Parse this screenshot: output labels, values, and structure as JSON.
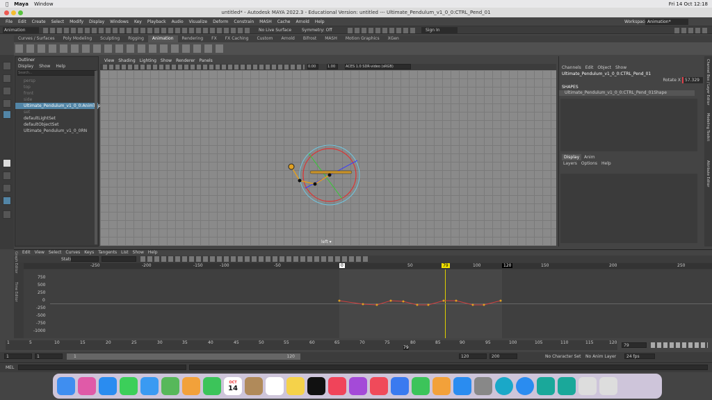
{
  "mac_menubar": {
    "app": "Maya",
    "window": "Window",
    "clock": "Fri 14 Oct  12:18"
  },
  "window_title": "untitled* - Autodesk MAYA 2022.3 - Educational Version: untitled   ---   Ultimate_Pendulum_v1_0_0:CTRL_Pend_01",
  "menubar": [
    "File",
    "Edit",
    "Create",
    "Select",
    "Modify",
    "Display",
    "Windows",
    "Key",
    "Playback",
    "Audio",
    "Visualize",
    "Deform",
    "Constrain",
    "MASH",
    "Cache",
    "Arnold",
    "Help"
  ],
  "workspace": {
    "label": "Workspace :",
    "value": "Animation*"
  },
  "statusline": {
    "menuset": "Animation",
    "live_surface": "No Live Surface",
    "symmetry": "Symmetry: Off",
    "sign_in": "Sign In"
  },
  "shelf_tabs": [
    "Curves / Surfaces",
    "Poly Modeling",
    "Sculpting",
    "Rigging",
    "Animation",
    "Rendering",
    "FX",
    "FX Caching",
    "Custom",
    "Arnold",
    "Bifrost",
    "MASH",
    "Motion Graphics",
    "XGen"
  ],
  "outliner": {
    "title": "Outliner",
    "menu": [
      "Display",
      "Show",
      "Help"
    ],
    "search_placeholder": "Search...",
    "items": [
      {
        "label": "persp",
        "dim": true
      },
      {
        "label": "top",
        "dim": true
      },
      {
        "label": "front",
        "dim": true
      },
      {
        "label": "side",
        "dim": true
      },
      {
        "label": "Ultimate_Pendulum_v1_0_0:AnimT_p",
        "sel": true
      },
      {
        "label": "set",
        "dim": true
      },
      {
        "label": "defaultLightSet"
      },
      {
        "label": "defaultObjectSet"
      },
      {
        "label": "Ultimate_Pendulum_v1_0_0RN"
      }
    ]
  },
  "viewport": {
    "menu": [
      "View",
      "Shading",
      "Lighting",
      "Show",
      "Renderer",
      "Panels"
    ],
    "field_a": "0.00",
    "field_b": "1.00",
    "colorspace": "ACES 1.0 SDR-video (sRGB)",
    "camera_label": "left ▾"
  },
  "channel_box": {
    "menu": [
      "Channels",
      "Edit",
      "Object",
      "Show"
    ],
    "object": "Ultimate_Pendulum_v1_0_0:CTRL_Pend_01",
    "attr_name": "Rotate X",
    "attr_value": "57.329",
    "shapes_label": "SHAPES",
    "shape": "Ultimate_Pendulum_v1_0_0:CTRL_Pend_01Shape"
  },
  "layer_editor": {
    "tabs": [
      "Display",
      "Anim"
    ],
    "menu": [
      "Layers",
      "Options",
      "Help"
    ]
  },
  "side_tabs": [
    "Channel Box / Layer Editor",
    "Modeling Toolkit",
    "Attribute Editor"
  ],
  "graph_editor": {
    "menu": [
      "Edit",
      "View",
      "Select",
      "Curves",
      "Keys",
      "Tangents",
      "List",
      "Show",
      "Help"
    ],
    "stats": "Stats",
    "frame_ticks": [
      "-250",
      "-200",
      "-150",
      "-100",
      "-50",
      "0",
      "50",
      "79",
      "100",
      "150",
      "200",
      "250"
    ],
    "value_ticks": [
      "750",
      "500",
      "250",
      "0",
      "-250",
      "-500",
      "-750",
      "-1000"
    ],
    "current_frame": "79",
    "end_frame": "120",
    "side_labels": [
      "Graph Editor",
      "Time Editor"
    ]
  },
  "timeline": {
    "ticks": [
      "1",
      "5",
      "10",
      "15",
      "20",
      "25",
      "30",
      "35",
      "40",
      "45",
      "50",
      "55",
      "60",
      "65",
      "70",
      "75",
      "80",
      "85",
      "90",
      "95",
      "100",
      "105",
      "110",
      "115",
      "120"
    ],
    "current": "79",
    "frame_field": "79"
  },
  "range": {
    "start": "1",
    "start2": "1",
    "range_start": "1",
    "range_end": "120",
    "end": "120",
    "end2": "200",
    "character_set": "No Character Set",
    "anim_layer": "No Anim Layer",
    "fps": "24 fps"
  },
  "mel": {
    "label": "MEL"
  },
  "dock": [
    {
      "name": "finder-icon",
      "c": "#3f8ef0"
    },
    {
      "name": "launchpad-icon",
      "c": "#e05aa8"
    },
    {
      "name": "safari-icon",
      "c": "#2a8cf0"
    },
    {
      "name": "messages-icon",
      "c": "#3ccf5a"
    },
    {
      "name": "mail-icon",
      "c": "#3a9af2"
    },
    {
      "name": "maps-icon",
      "c": "#57b85a"
    },
    {
      "name": "photos-icon",
      "c": "#f2a13a"
    },
    {
      "name": "facetime-icon",
      "c": "#3cc45a"
    },
    {
      "name": "calendar-icon",
      "c": "#ffffff"
    },
    {
      "name": "contacts-icon",
      "c": "#b08a5a"
    },
    {
      "name": "reminders-icon",
      "c": "#ffffff"
    },
    {
      "name": "notes-icon",
      "c": "#f5d24a"
    },
    {
      "name": "tv-icon",
      "c": "#111111"
    },
    {
      "name": "music-icon",
      "c": "#f0445a"
    },
    {
      "name": "podcasts-icon",
      "c": "#a44ad8"
    },
    {
      "name": "news-icon",
      "c": "#f04a5a"
    },
    {
      "name": "keynote-icon",
      "c": "#3a7af0"
    },
    {
      "name": "numbers-icon",
      "c": "#3cc45a"
    },
    {
      "name": "pages-icon",
      "c": "#f2a13a"
    },
    {
      "name": "appstore-icon",
      "c": "#2a8cf0"
    },
    {
      "name": "settings-icon",
      "c": "#888888"
    },
    {
      "name": "edge-icon",
      "c": "#1aa8c8"
    },
    {
      "name": "word-icon",
      "c": "#2a8cf0"
    },
    {
      "name": "maya-icon",
      "c": "#1aa89a"
    },
    {
      "name": "maya-doc-icon",
      "c": "#1aa89a"
    },
    {
      "name": "mail-doc-icon",
      "c": "#dddddd"
    },
    {
      "name": "trash-icon",
      "c": "#dddddd"
    }
  ],
  "calendar": {
    "month": "OCT",
    "day": "14"
  }
}
